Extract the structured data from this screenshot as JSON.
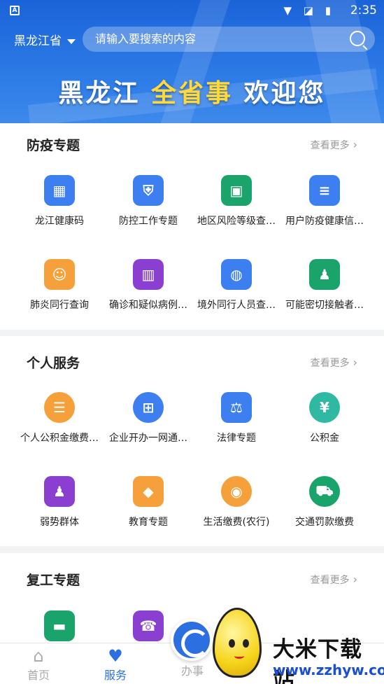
{
  "status_bar": {
    "app_letter": "A",
    "time": "2:35",
    "icons": "▼ ◪ ▮"
  },
  "header": {
    "province": "黑龙江省",
    "search_placeholder": "请输入要搜索的内容",
    "welcome_part1": "黑龙江",
    "welcome_highlight": "全省事",
    "welcome_part2": "欢迎您"
  },
  "sections": [
    {
      "title": "防疫专题",
      "more": "查看更多",
      "items": [
        {
          "label": "龙江健康码",
          "icon": "qr-code-icon",
          "color": "#3d7ef0"
        },
        {
          "label": "防控工作专题",
          "icon": "shield-thermometer-icon",
          "color": "#3d7ef0"
        },
        {
          "label": "地区风险等级查…",
          "icon": "id-card-icon",
          "color": "#1aa36a"
        },
        {
          "label": "用户防疫健康信…",
          "icon": "document-icon",
          "color": "#3d7ef0"
        },
        {
          "label": "肺炎同行查询",
          "icon": "people-search-icon",
          "color": "#f5a03a"
        },
        {
          "label": "确诊和疑似病例…",
          "icon": "bar-chart-icon",
          "color": "#8a3fd1"
        },
        {
          "label": "境外同行人员查…",
          "icon": "globe-monitor-icon",
          "color": "#3d7ef0"
        },
        {
          "label": "可能密切接触者…",
          "icon": "contact-people-icon",
          "color": "#1aa36a"
        }
      ]
    },
    {
      "title": "个人服务",
      "more": "查看更多",
      "items": [
        {
          "label": "个人公积金缴费…",
          "icon": "fund-receipt-icon",
          "color": "#f5a03a"
        },
        {
          "label": "企业开办一网通…",
          "icon": "enterprise-doc-icon",
          "color": "#3d7ef0"
        },
        {
          "label": "法律专题",
          "icon": "gavel-icon",
          "color": "#3d7ef0"
        },
        {
          "label": "公积金",
          "icon": "house-yuan-icon",
          "color": "#2fb9a3"
        },
        {
          "label": "弱势群体",
          "icon": "group-icon",
          "color": "#8a3fd1"
        },
        {
          "label": "教育专题",
          "icon": "graduation-cap-icon",
          "color": "#f5a03a"
        },
        {
          "label": "生活缴费(农行)",
          "icon": "location-pay-icon",
          "color": "#f5a03a"
        },
        {
          "label": "交通罚款缴费",
          "icon": "car-fine-icon",
          "color": "#1aa36a"
        }
      ]
    },
    {
      "title": "复工专题",
      "more": "查看更多",
      "items": [
        {
          "label": "",
          "icon": "briefcase-icon",
          "color": "#1aa36a"
        },
        {
          "label": "",
          "icon": "phone-icon",
          "color": "#8a3fd1"
        }
      ]
    }
  ],
  "bottom_nav": {
    "home": "首页",
    "service": "服务",
    "affairs": "办事"
  },
  "watermark": {
    "title": "大米下载站",
    "url": "www.zzhyw.com"
  }
}
